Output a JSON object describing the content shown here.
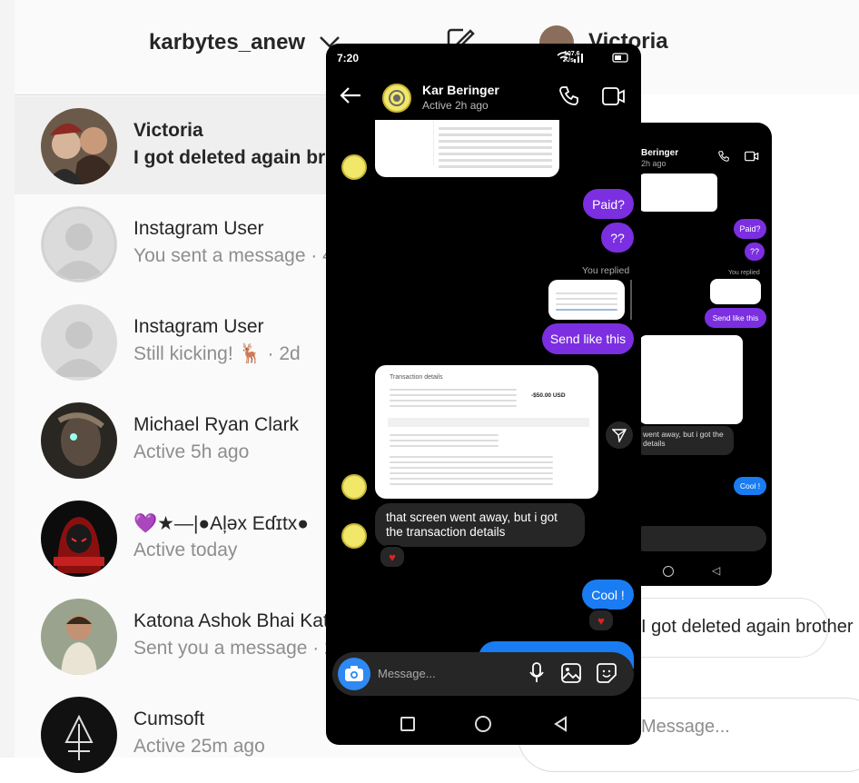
{
  "account": {
    "username": "karbytes_anew"
  },
  "conversation": {
    "name": "Victoria",
    "last_message": "I got deleted again brother",
    "input_placeholder": "Message..."
  },
  "threads": [
    {
      "name": "Victoria",
      "subtitle": "I got deleted again br"
    },
    {
      "name": "Instagram User",
      "subtitle": "You sent a message · 4"
    },
    {
      "name": "Instagram User",
      "subtitle": "Still kicking! 🦌 · 2d"
    },
    {
      "name": "Michael Ryan Clark",
      "subtitle": "Active 5h ago"
    },
    {
      "name": "💜★—|●Aļəx Eɗɪtx●",
      "subtitle": "Active today"
    },
    {
      "name": "Katona Ashok Bhai Kat",
      "subtitle": "Sent you a message · 2"
    },
    {
      "name": "Cumsoft",
      "subtitle": "Active 25m ago"
    }
  ],
  "phone": {
    "status_time": "7:20",
    "status_speed": "107.6 K/s",
    "contact_name": "Kar Beringer",
    "contact_status": "Active 2h ago",
    "messages": {
      "paid": "Paid?",
      "qq": "??",
      "you_replied": "You replied",
      "send_like_this": "Send like this",
      "screen_went_away": "that screen went away, but i got the transaction details",
      "cool": "Cool !"
    },
    "receipt": {
      "title": "Transaction details",
      "amount": "-$50.00 USD"
    },
    "composer_placeholder": "Message..."
  },
  "phone2": {
    "contact_name": "Beringer",
    "contact_status": "2h ago",
    "messages": {
      "paid": "Paid?",
      "qq": "??",
      "you_replied": "You replied",
      "send_like_this": "Send like this",
      "went_away": "went away, but i got the details",
      "cool": "Cool !"
    }
  },
  "colors": {
    "purple": "#7b2fe0",
    "blue": "#1a7cf2",
    "camera": "#2e89f2"
  }
}
